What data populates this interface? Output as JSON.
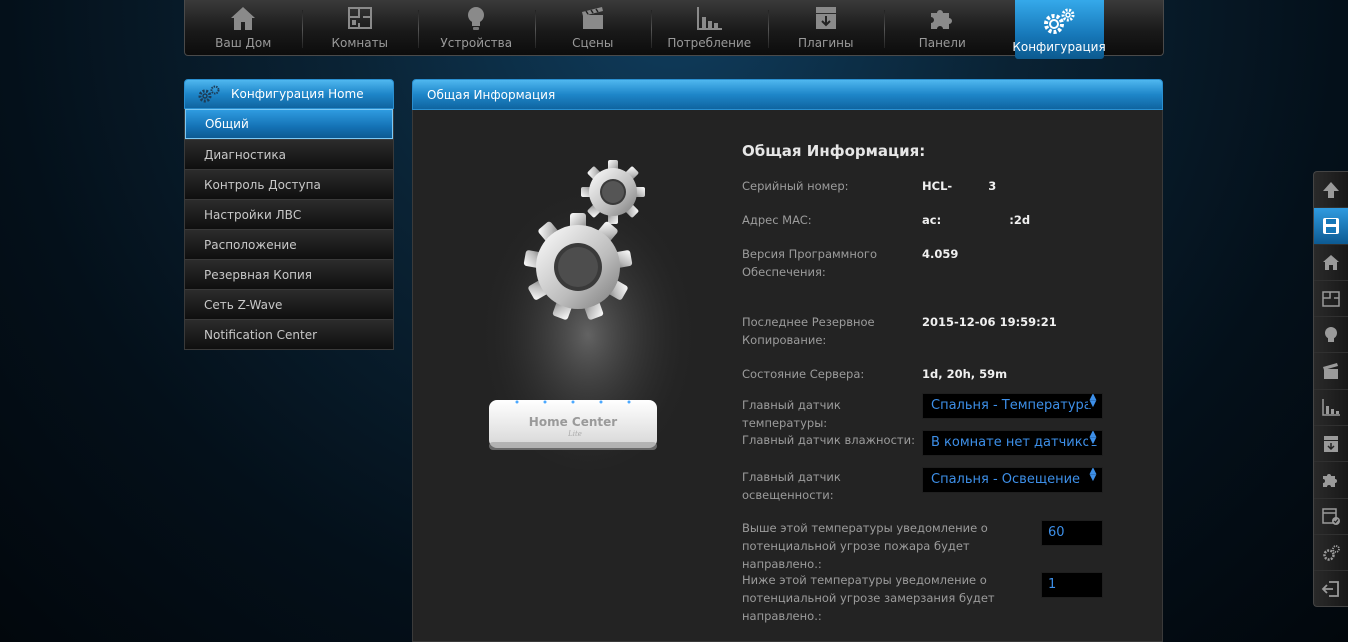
{
  "nav": {
    "items": [
      {
        "label": "Ваш Дом",
        "icon": "house-icon"
      },
      {
        "label": "Комнаты",
        "icon": "floorplan-icon"
      },
      {
        "label": "Устройства",
        "icon": "lightbulb-icon"
      },
      {
        "label": "Сцены",
        "icon": "clapperboard-icon"
      },
      {
        "label": "Потребление",
        "icon": "bar-chart-icon"
      },
      {
        "label": "Плагины",
        "icon": "download-box-icon"
      },
      {
        "label": "Панели",
        "icon": "puzzle-icon"
      },
      {
        "label": "Конфигурация",
        "icon": "gears-icon"
      }
    ],
    "active_index": 7
  },
  "sidebar": {
    "title": "Конфигурация Home",
    "items": [
      {
        "label": "Общий"
      },
      {
        "label": "Диагностика"
      },
      {
        "label": "Контроль Доступа"
      },
      {
        "label": "Настройки ЛВС"
      },
      {
        "label": "Расположение"
      },
      {
        "label": "Резервная Копия"
      },
      {
        "label": "Сеть Z-Wave"
      },
      {
        "label": "Notification Center"
      }
    ],
    "active_index": 0
  },
  "main": {
    "panel_title": "Общая Информация",
    "device_label": "Home Center",
    "device_sublabel": "Lite",
    "info": {
      "title": "Общая Информация:",
      "serial_label": "Серийный номер:",
      "serial_value": "HCL-         3",
      "mac_label": "Адрес MAC:",
      "mac_value": "ac:                 :2d",
      "firmware_label": "Версия Программного Обеспечения:",
      "firmware_value": "4.059",
      "backup_label": "Последнее Резервное Копирование:",
      "backup_value": "2015-12-06 19:59:21",
      "server_label": "Состояние Сервера:",
      "server_value": "1d, 20h, 59m",
      "temp_sensor_label": "Главный датчик температуры:",
      "temp_sensor_value": "Спальня - Температура",
      "humidity_sensor_label": "Главный датчик влажности:",
      "humidity_sensor_value": "В комнате нет датчиков т",
      "light_sensor_label": "Главный датчик освещенности:",
      "light_sensor_value": "Спальня - Освещение",
      "fire_label": "Выше этой температуры уведомление о потенциальной угрозе пожара будет направлено.:",
      "fire_value": "60",
      "freeze_label": "Ниже этой температуры уведомление о потенциальной угрозе замерзания будет направлено.:",
      "freeze_value": "1"
    }
  },
  "right_toolbar": {
    "items": [
      "arrow-up-icon",
      "save-icon",
      "house-icon",
      "floorplan-icon",
      "lightbulb-icon",
      "clapperboard-icon",
      "bar-chart-icon",
      "download-box-icon",
      "puzzle-icon",
      "calendar-check-icon",
      "gears-icon",
      "logout-icon"
    ],
    "active_index": 1
  },
  "colors": {
    "accent": "#1e86c9",
    "select_text": "#3d8fe8"
  }
}
